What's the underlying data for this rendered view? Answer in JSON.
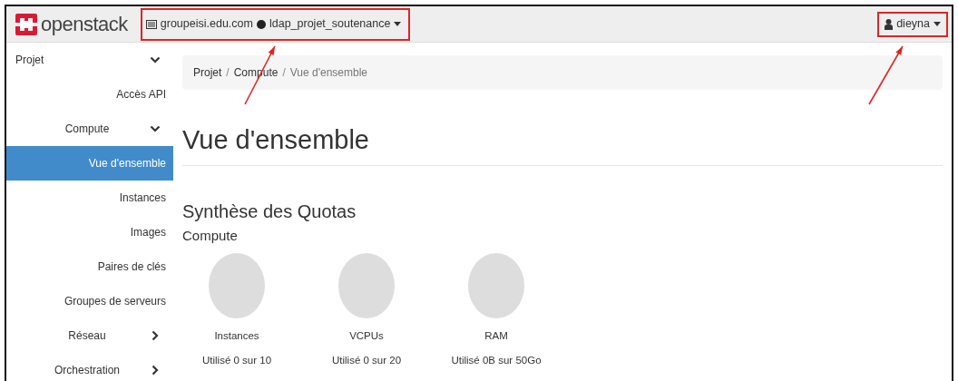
{
  "navbar": {
    "brand": "openstack",
    "project_selector": {
      "domain": "groupeisi.edu.com",
      "project": "ldap_projet_soutenance",
      "highlighted": true
    },
    "user_menu": {
      "label": "dieyna",
      "highlighted": true
    }
  },
  "sidebar": {
    "items": [
      {
        "label": "Projet",
        "expanded": true,
        "selected": false,
        "children": [
          {
            "label": "Accès API",
            "selected": false
          },
          {
            "label": "Compute",
            "expanded": true,
            "selected": false,
            "children": [
              {
                "label": "Vue d'ensemble",
                "selected": true
              },
              {
                "label": "Instances",
                "selected": false
              },
              {
                "label": "Images",
                "selected": false
              },
              {
                "label": "Paires de clés",
                "selected": false
              },
              {
                "label": "Groupes de serveurs",
                "selected": false
              }
            ]
          },
          {
            "label": "Réseau",
            "expanded": false,
            "selected": false
          },
          {
            "label": "Orchestration",
            "expanded": false,
            "selected": false
          }
        ]
      }
    ]
  },
  "breadcrumb": [
    {
      "label": "Projet",
      "separator": "/"
    },
    {
      "label": "Compute",
      "separator": "/"
    },
    {
      "label": "Vue d'ensemble"
    }
  ],
  "page_title": "Vue d'ensemble",
  "section_title": "Synthèse des Quotas",
  "subsection_title": "Compute",
  "quotas": [
    {
      "name": "Instances",
      "usage": "Utilisé 0 sur 10"
    },
    {
      "name": "VCPUs",
      "usage": "Utilisé 0 sur 20"
    },
    {
      "name": "RAM",
      "usage": "Utilisé 0B sur 50Go"
    }
  ]
}
